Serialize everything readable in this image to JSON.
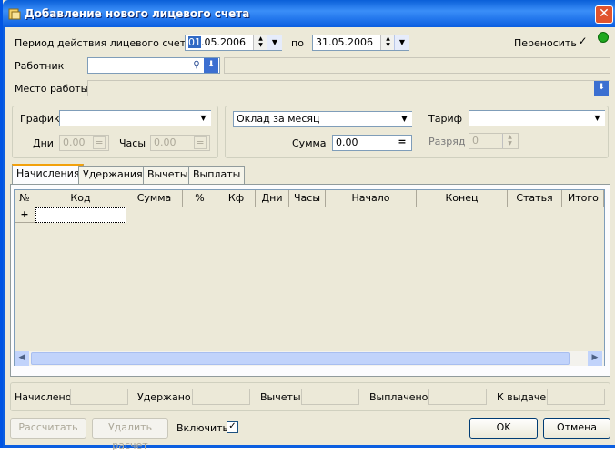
{
  "window": {
    "title": "Добавление нового лицевого счета",
    "close_label": "✕"
  },
  "period": {
    "label": "Период действия лицевого счета с",
    "from_day": "01",
    "from_rest": ".05.2006",
    "to_label": "по",
    "to": "31.05.2006"
  },
  "transfer": {
    "label": "Переносить",
    "checked": "✓"
  },
  "worker": {
    "label": "Работник",
    "value": ""
  },
  "workplace": {
    "label": "Место работы"
  },
  "schedule": {
    "label": "График",
    "days_label": "Дни",
    "days": "0.00",
    "hours_label": "Часы",
    "hours": "0.00"
  },
  "salary": {
    "type": "Оклад за месяц",
    "sum_label": "Сумма",
    "sum": "0.00"
  },
  "tariff": {
    "label": "Тариф",
    "rank_label": "Разряд",
    "rank": "0"
  },
  "tabs": [
    "Начисления",
    "Удержания",
    "Вычеты",
    "Выплаты"
  ],
  "grid": {
    "columns": [
      "№",
      "Код",
      "Сумма",
      "%",
      "Кф",
      "Дни",
      "Часы",
      "Начало",
      "Конец",
      "Статья",
      "Итого"
    ],
    "new_row_marker": "+"
  },
  "totals": {
    "accrued": "Начислено",
    "withheld": "Удержано",
    "deductions": "Вычеты",
    "paid": "Выплачено",
    "to_pay": "К выдаче"
  },
  "footer": {
    "calc": "Рассчитать",
    "delete_calc": "Удалить расчет",
    "include": "Включить",
    "include_checked": "✓",
    "ok": "OK",
    "cancel": "Отмена"
  },
  "colors": {
    "status_indicator": "#1fa81f",
    "titlebar": "#0b5ee0"
  }
}
